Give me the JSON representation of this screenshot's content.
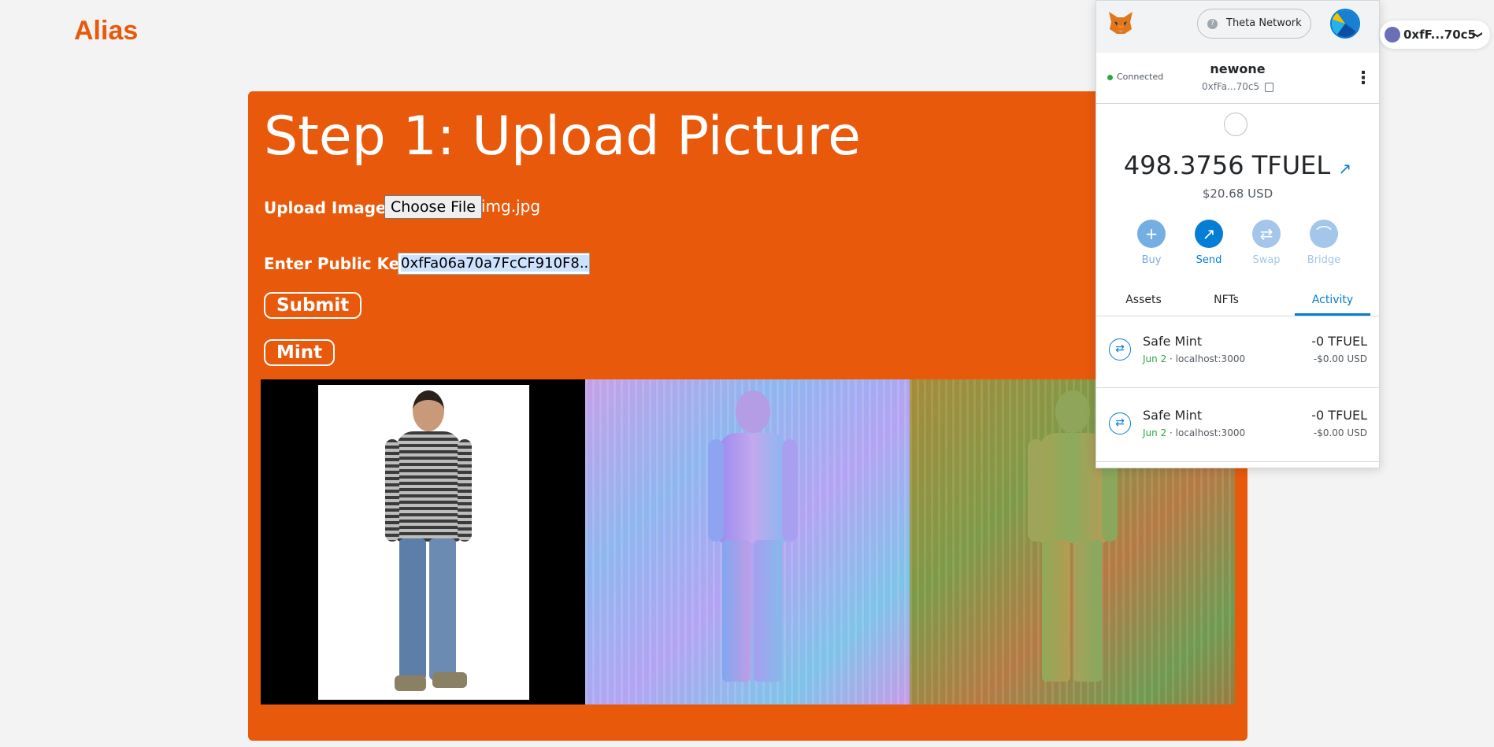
{
  "app": {
    "brand": "Alias"
  },
  "form": {
    "title": "Step 1: Upload Picture",
    "upload_label": "Upload Image:",
    "choose_file_label": "Choose File",
    "file_name": "img.jpg",
    "public_key_label": "Enter Public Key:",
    "public_key_value": "0xfFa06a70a7FcCF910F8...",
    "submit_label": "Submit",
    "mint_label": "Mint"
  },
  "colors": {
    "accent": "#e8590c",
    "metamask_blue": "#037dd6",
    "success_green": "#28a745"
  },
  "wallet": {
    "network": "Theta Network",
    "status": "Connected",
    "account_name": "newone",
    "account_address": "0xfFa...70c5",
    "balance": "498.3756 TFUEL",
    "fiat": "$20.68 USD",
    "actions": [
      {
        "label": "Buy",
        "icon": "+"
      },
      {
        "label": "Send",
        "icon": "↗"
      },
      {
        "label": "Swap",
        "icon": "⇄"
      },
      {
        "label": "Bridge",
        "icon": "⌒"
      }
    ],
    "tabs": [
      "Assets",
      "NFTs",
      "Activity"
    ],
    "active_tab": "Activity",
    "transactions": [
      {
        "title": "Safe Mint",
        "date": "Jun 2",
        "origin": " · localhost:3000",
        "amount": "-0 TFUEL",
        "usd": "-$0.00 USD"
      },
      {
        "title": "Safe Mint",
        "date": "Jun 2",
        "origin": " · localhost:3000",
        "amount": "-0 TFUEL",
        "usd": "-$0.00 USD"
      }
    ]
  },
  "account_chip": {
    "address": "0xfF...70c5"
  }
}
